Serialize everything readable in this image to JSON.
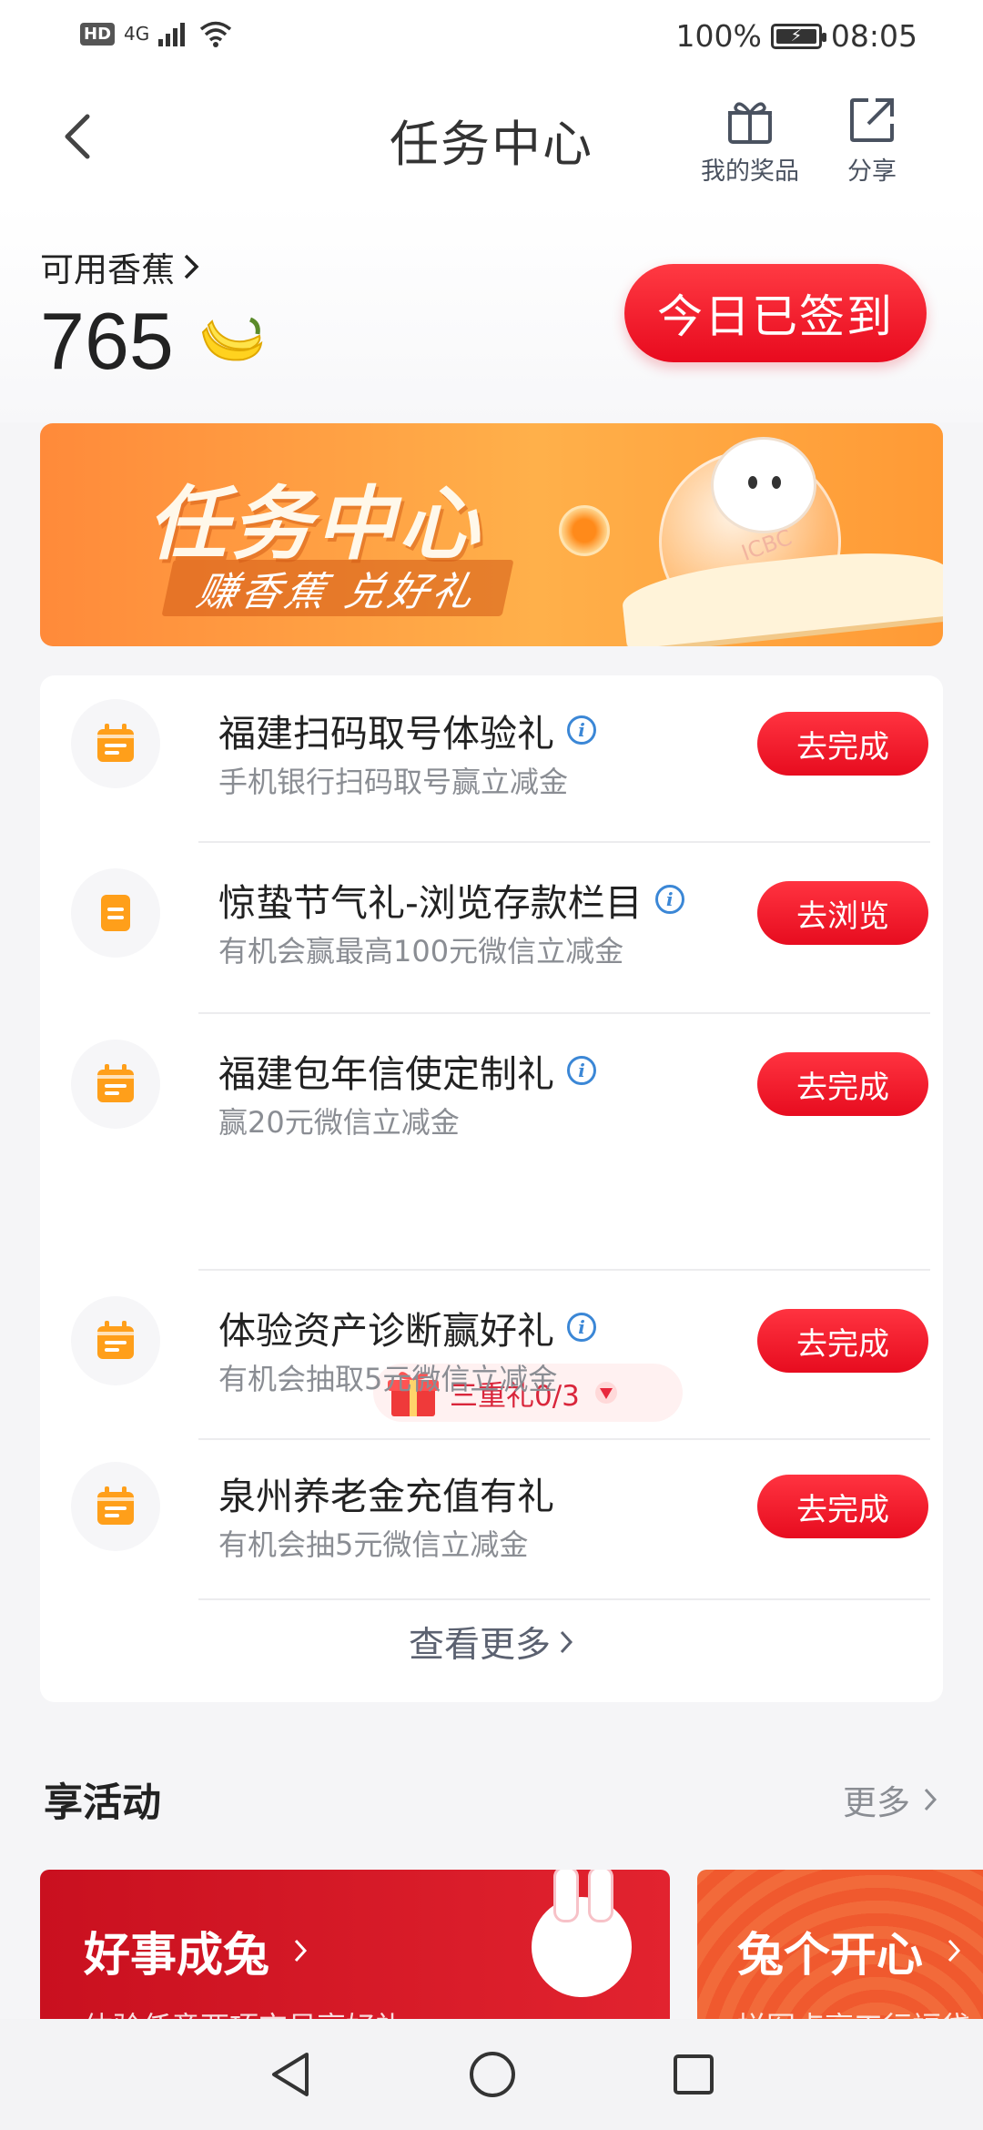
{
  "status_bar": {
    "hd_label": "HD",
    "signal_label": "4G",
    "battery_percent": "100%",
    "time": "08:05"
  },
  "header": {
    "title": "任务中心",
    "prizes_label": "我的奖品",
    "share_label": "分享"
  },
  "banana": {
    "label": "可用香蕉",
    "count": "765",
    "signed_label": "今日已签到"
  },
  "banner": {
    "title": "任务中心",
    "subtitle": "赚香蕉 兑好礼",
    "brand_text": "ICBC"
  },
  "tasks": [
    {
      "title": "福建扫码取号体验礼",
      "subtitle": "手机银行扫码取号赢立减金",
      "button": "去完成",
      "has_info": true
    },
    {
      "title": "惊蛰节气礼-浏览存款栏目",
      "subtitle": "有机会赢最高100元微信立减金",
      "button": "去浏览",
      "has_info": true
    },
    {
      "title": "福建包年信使定制礼",
      "subtitle": "赢20元微信立减金",
      "button": "去完成",
      "has_info": true,
      "gift_label": "三重礼0/3"
    },
    {
      "title": "体验资产诊断赢好礼",
      "subtitle": "有机会抽取5元微信立减金",
      "button": "去完成",
      "has_info": true
    },
    {
      "title": "泉州养老金充值有礼",
      "subtitle": "有机会抽5元微信立减金",
      "button": "去完成",
      "has_info": false
    }
  ],
  "tasks_more": "查看更多",
  "activities": {
    "title": "享活动",
    "more_label": "更多",
    "cards": [
      {
        "name": "好事成兔",
        "subtitle": "体验任意两项交易享好礼"
      },
      {
        "name": "兔个开心",
        "subtitle": "拼图点亮工行福袋"
      }
    ]
  },
  "colors": {
    "primary_red": "#e80a1e",
    "banner_orange": "#ff9a35",
    "info_blue": "#3b87d6"
  }
}
